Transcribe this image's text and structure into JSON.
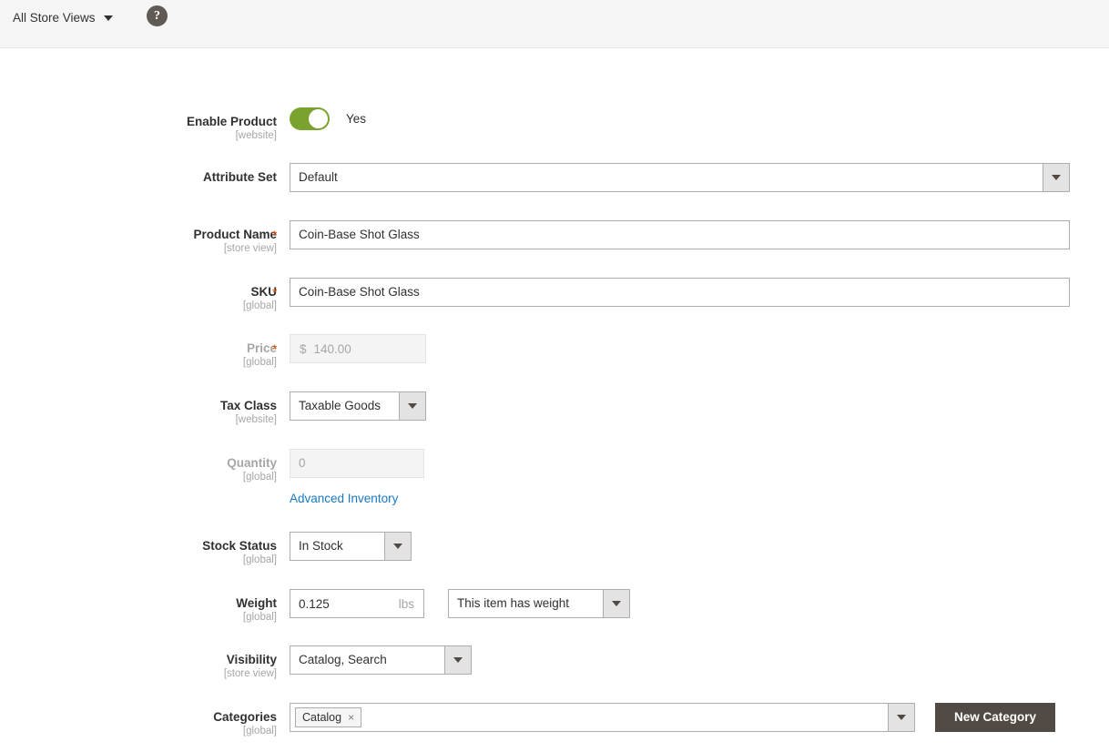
{
  "topbar": {
    "store_view_label": "All Store Views",
    "help_icon_glyph": "?"
  },
  "form": {
    "enable_product": {
      "label": "Enable Product",
      "scope": "[website]",
      "toggle_state": "on",
      "toggle_text": "Yes"
    },
    "attribute_set": {
      "label": "Attribute Set",
      "scope": "",
      "value": "Default"
    },
    "product_name": {
      "label": "Product Name",
      "scope": "[store view]",
      "required": "*",
      "value": "Coin-Base Shot Glass"
    },
    "sku": {
      "label": "SKU",
      "scope": "[global]",
      "required": "*",
      "value": "Coin-Base Shot Glass"
    },
    "price": {
      "label": "Price",
      "scope": "[global]",
      "required": "*",
      "currency": "$",
      "value": "140.00",
      "disabled": true
    },
    "tax_class": {
      "label": "Tax Class",
      "scope": "[website]",
      "value": "Taxable Goods"
    },
    "quantity": {
      "label": "Quantity",
      "scope": "[global]",
      "value": "0",
      "disabled": true,
      "advanced_inventory_link": "Advanced Inventory"
    },
    "stock_status": {
      "label": "Stock Status",
      "scope": "[global]",
      "value": "In Stock"
    },
    "weight": {
      "label": "Weight",
      "scope": "[global]",
      "value": "0.125",
      "unit": "lbs",
      "has_weight_value": "This item has weight"
    },
    "visibility": {
      "label": "Visibility",
      "scope": "[store view]",
      "value": "Catalog, Search"
    },
    "categories": {
      "label": "Categories",
      "scope": "[global]",
      "chips": [
        {
          "label": "Catalog",
          "remove_glyph": "×"
        }
      ],
      "new_category_button": "New Category"
    }
  },
  "colors": {
    "accent_green": "#79a22e",
    "link_blue": "#1979c3",
    "required_orange": "#e25203",
    "button_dark": "#514943",
    "topbar_bg": "#f5f5f5"
  }
}
